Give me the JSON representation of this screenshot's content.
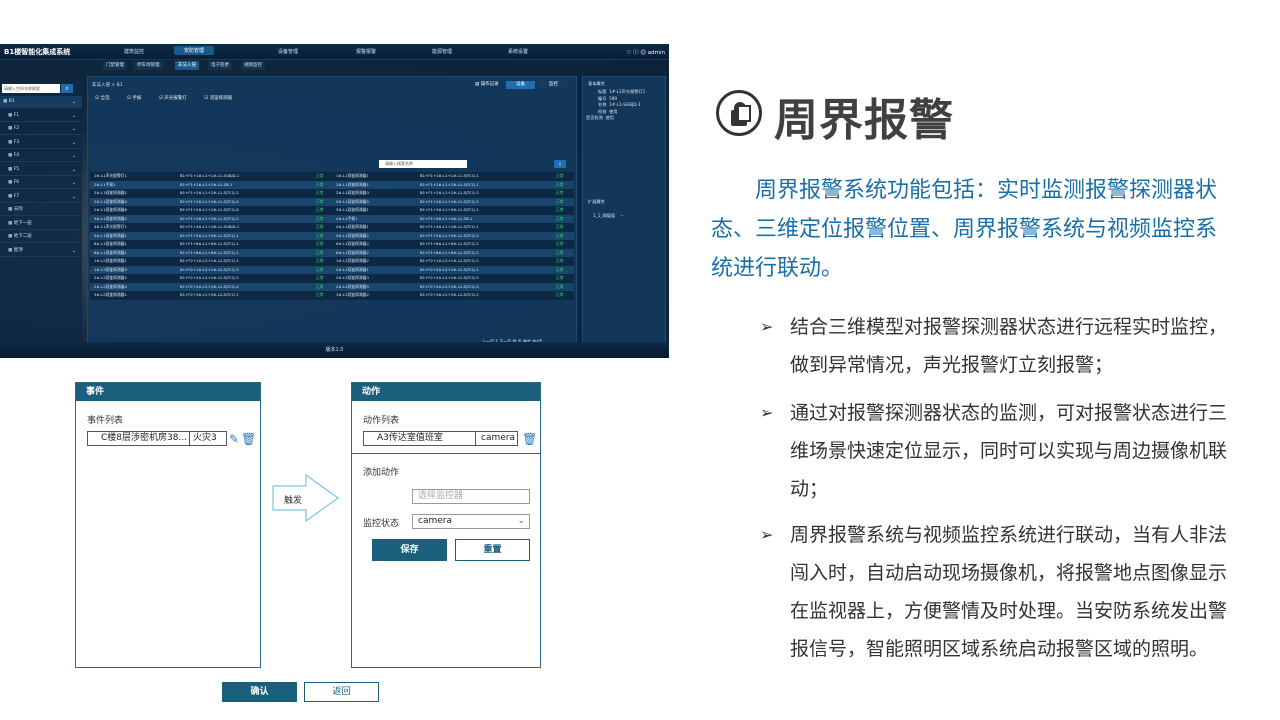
{
  "app": {
    "title": "B1楼智能化集成系统",
    "nav": [
      "建筑监控",
      "安防管理",
      "设备管理",
      "报警报警",
      "能源管理",
      "系统设置"
    ],
    "nav_active": "安防管理",
    "user": "admin",
    "subtabs": [
      "门禁管理",
      "停车场管理",
      "非法入侵",
      "电子巡更",
      "视频监控"
    ],
    "subtab_active": "非法入侵",
    "sidebar": {
      "search_placeholder": "请输入空间名称搜索",
      "items": [
        "B1",
        "F1",
        "F2",
        "F3",
        "F4",
        "F5",
        "F6",
        "F7",
        "天际",
        "地下一层",
        "地下二层",
        "屋顶"
      ]
    },
    "breadcrumb": "非法入侵 > B1",
    "checks": [
      "全选",
      "手报",
      "声光报警灯",
      "双鉴探测器"
    ],
    "toolbar": {
      "record": "操作记录",
      "device": "设备",
      "control": "监控"
    },
    "table_search_placeholder": "请输入搜索名称",
    "rows": [
      [
        "1#-L1声光报警灯1",
        "B1+F1+1#-L1+1#-L1-SGBJD-1",
        "正常",
        "1#-L1双鉴探测器1",
        "B1+F1+1#-L1+1#-L1-SJTCQ-1",
        "正常"
      ],
      [
        "2#-L1手报1",
        "B1+F1+2#-L1+2#-L1-SB-1",
        "正常",
        "2#-L1双鉴探测器1",
        "B1+F1+2#-L1+2#-L1-SJTCQ-1",
        "正常"
      ],
      [
        "2#-L1双鉴探测器2",
        "B1+F1+2#-L1+2#-L1-SJTCQ-2",
        "正常",
        "2#-L1双鉴探测器3",
        "B1+F1+2#-L1+2#-L1-SJTCQ-3",
        "正常"
      ],
      [
        "2#-L1双鉴探测器4",
        "B1+F1+2#-L1+2#-L1-SJTCQ-4",
        "正常",
        "2#-L1双鉴探测器5",
        "B1+F1+2#-L1+2#-L1-SJTCQ-5",
        "正常"
      ],
      [
        "2#-L1双鉴探测器6",
        "B1+F1+2#-L1+2#-L1-SJTCQ-6",
        "正常",
        "3#-L1双鉴探测器1",
        "B1+F1+3#-L1+3#-L1-SJTCQ-1",
        "正常"
      ],
      [
        "3#-L1双鉴探测器2",
        "B1+F1+3#-L1+3#-L1-SJTCQ-2",
        "正常",
        "4#-L1手报1",
        "B1+F1+4#-L1+4#-L1-SB-1",
        "正常"
      ],
      [
        "4#-L1声光报警灯1",
        "B1+F1+4#-L1+4#-L1-SGBJD-1",
        "正常",
        "4#-L1双鉴探测器1",
        "B1+F1+4#-L1+4#-L1-SJTCQ-1",
        "正常"
      ],
      [
        "5#-L1双鉴探测器1",
        "B1+F1+5#-L1+5#-L1-SJTCQ-1",
        "正常",
        "5#-L1双鉴探测器2",
        "B1+F1+5#-L1+5#-L1-SJTCQ-2",
        "正常"
      ],
      [
        "6#-L1双鉴探测器1",
        "B1+F1+6#-L1+6#-L1-SJTCQ-1",
        "正常",
        "6#-L1双鉴探测器2",
        "B1+F1+6#-L1+6#-L1-SJTCQ-2",
        "正常"
      ],
      [
        "8#-L1双鉴探测器1",
        "B1+F1+8#-L1+8#-L1-SJTCQ-1",
        "正常",
        "8#-L1双鉴探测器2",
        "B1+F1+8#-L1+8#-L1-SJTCQ-2",
        "正常"
      ],
      [
        "1#-L2双鉴探测器1",
        "B1+F2+1#-L2+1#-L2-SJTCQ-1",
        "正常",
        "1#-L2双鉴探测器2",
        "B1+F2+1#-L2+1#-L2-SJTCQ-2",
        "正常"
      ],
      [
        "1#-L2双鉴探测器3",
        "B1+F2+1#-L2+1#-L2-SJTCQ-3",
        "正常",
        "2#-L2双鉴探测器1",
        "B1+F2+2#-L2+2#-L2-SJTCQ-1",
        "正常"
      ],
      [
        "2#-L2双鉴探测器2",
        "B1+F2+2#-L2+2#-L2-SJTCQ-2",
        "正常",
        "2#-L2双鉴探测器3",
        "B1+F2+2#-L2+2#-L2-SJTCQ-3",
        "正常"
      ],
      [
        "2#-L2双鉴探测器4",
        "B1+F2+2#-L2+2#-L2-SJTCQ-4",
        "正常",
        "2#-L2双鉴探测器5",
        "B1+F2+2#-L2+2#-L2-SJTCQ-5",
        "正常"
      ],
      [
        "3#-L2双鉴探测器1",
        "B1+F2+3#-L2+3#-L2-SJTCQ-1",
        "正常",
        "3#-L2双鉴探测器2",
        "B1+F2+3#-L2+3#-L2-SJTCQ-2",
        "正常"
      ]
    ],
    "pager": {
      "prev": "上一页",
      "page": "1",
      "next": "下一页",
      "goto": "到",
      "page_unit": "页",
      "confirm": "确定",
      "total": "共4页"
    },
    "right_panel": {
      "basic_title": "基本属性",
      "basic": [
        [
          "标题",
          "1#-L1声光报警灯1"
        ],
        [
          "编号",
          "599"
        ],
        [
          "名称",
          "1#-L1-SGBJD-1"
        ],
        [
          "检修",
          "使用"
        ],
        [
          "是否检测",
          "使用"
        ]
      ],
      "ext_title": "扩展属性",
      "ext": [
        [
          "1_1_阈值值",
          "--"
        ]
      ]
    },
    "version": "版本1.0"
  },
  "event_panel": {
    "title": "事件",
    "list_label": "事件列表",
    "item_name": "C楼8层涉密机房38...",
    "item_type": "火灾3"
  },
  "trigger_label": "触发",
  "action_panel": {
    "title": "动作",
    "list_label": "动作列表",
    "item_name": "A3传达室值班室",
    "item_type": "camera",
    "add_label": "添加动作",
    "monitor_placeholder": "选择监控器",
    "state_label": "监控状态",
    "state_value": "camera",
    "save": "保存",
    "reset": "重置"
  },
  "confirm_button": "确认",
  "back_button": "返回",
  "heading": "周界报警",
  "intro": "周界报警系统功能包括：实时监测报警探测器状态、三维定位报警位置、周界报警系统与视频监控系统进行联动。",
  "bullets": [
    "结合三维模型对报警探测器状态进行远程实时监控，做到异常情况，声光报警灯立刻报警；",
    "通过对报警探测器状态的监测，可对报警状态进行三维场景快速定位显示，同时可以实现与周边摄像机联动；",
    "周界报警系统与视频监控系统进行联动，当有人非法闯入时，自动启动现场摄像机，将报警地点图像显示在监视器上，方便警情及时处理。当安防系统发出警报信号，智能照明区域系统启动报警区域的照明。"
  ],
  "colors": {
    "heading": "#404040",
    "intro": "#1a6fa8",
    "panel_header": "#1a5f7c",
    "app_bg": "#0b2238",
    "status_ok": "#33dd66"
  }
}
